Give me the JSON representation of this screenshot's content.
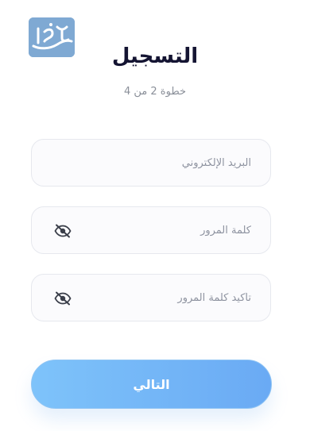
{
  "brand": {
    "logo_text": "المرجع",
    "logo_color": "#7fa9d3"
  },
  "header": {
    "title": "التسجيل",
    "step": "خطوة 2 من 4"
  },
  "form": {
    "email_placeholder": "البريد الإلكتروني",
    "password_placeholder": "كلمة المرور",
    "confirm_placeholder": "تأكيد كلمة المرور",
    "visibility_icon": "eye-off-icon",
    "next_label": "التالي"
  },
  "colors": {
    "title": "#141432",
    "button_start": "#7ec3fa",
    "button_end": "#6aaaf4"
  }
}
